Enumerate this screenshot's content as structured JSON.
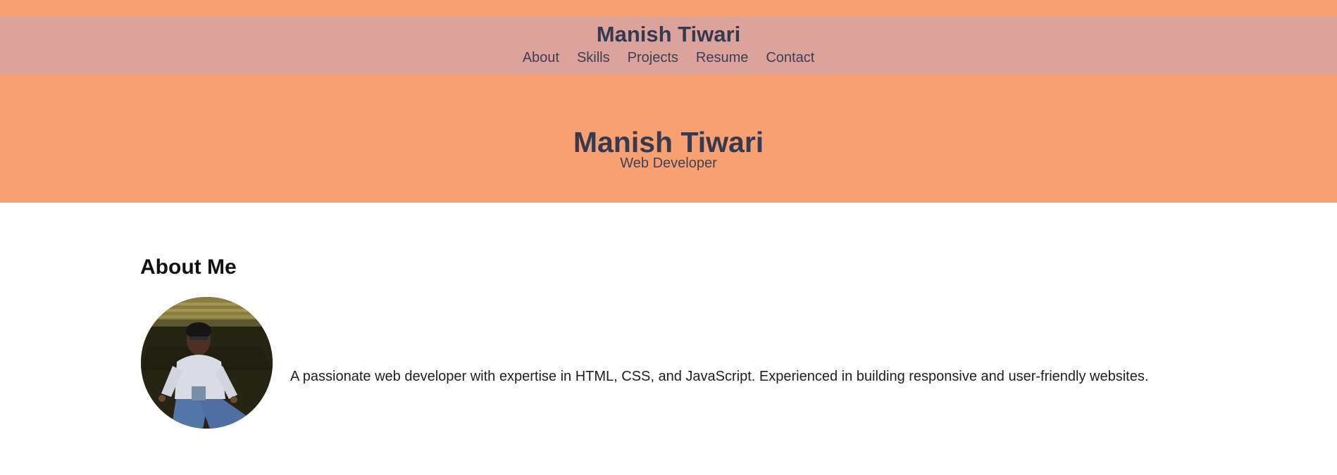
{
  "header": {
    "brand": "Manish Tiwari",
    "nav": [
      {
        "label": "About"
      },
      {
        "label": "Skills"
      },
      {
        "label": "Projects"
      },
      {
        "label": "Resume"
      },
      {
        "label": "Contact"
      }
    ]
  },
  "hero": {
    "title": "Manish Tiwari",
    "subtitle": "Web Developer"
  },
  "about": {
    "heading": "About Me",
    "photo_icon": "profile-photo",
    "text": "A passionate web developer with expertise in HTML, CSS, and JavaScript. Experienced in building responsive and user-friendly websites."
  },
  "colors": {
    "hero_background": "#f7a072",
    "navbar_background": "#dca39c",
    "title_text": "#363a4e"
  }
}
